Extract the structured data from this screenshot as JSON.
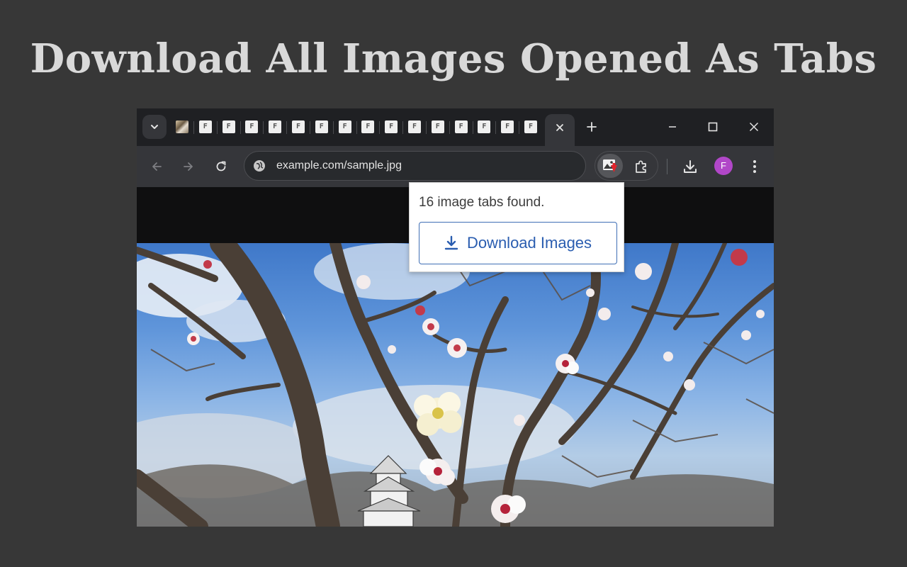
{
  "headline": "Download All Images Opened As Tabs",
  "browser": {
    "tabs": {
      "favicons": [
        "photo",
        "F",
        "F",
        "F",
        "F",
        "F",
        "F",
        "F",
        "F",
        "F",
        "F",
        "F",
        "F",
        "F",
        "F",
        "F"
      ],
      "file_letter": "F"
    },
    "window_controls": {
      "minimize_icon": "minimize-icon",
      "maximize_icon": "maximize-icon",
      "close_icon": "close-icon"
    },
    "address_bar": {
      "url": "example.com/sample.jpg"
    },
    "profile_initial": "F",
    "colors": {
      "avatar": "#b147c8",
      "popup_button": "#2a5db0"
    }
  },
  "popup": {
    "message": "16 image tabs found.",
    "button_label": "Download Images"
  }
}
